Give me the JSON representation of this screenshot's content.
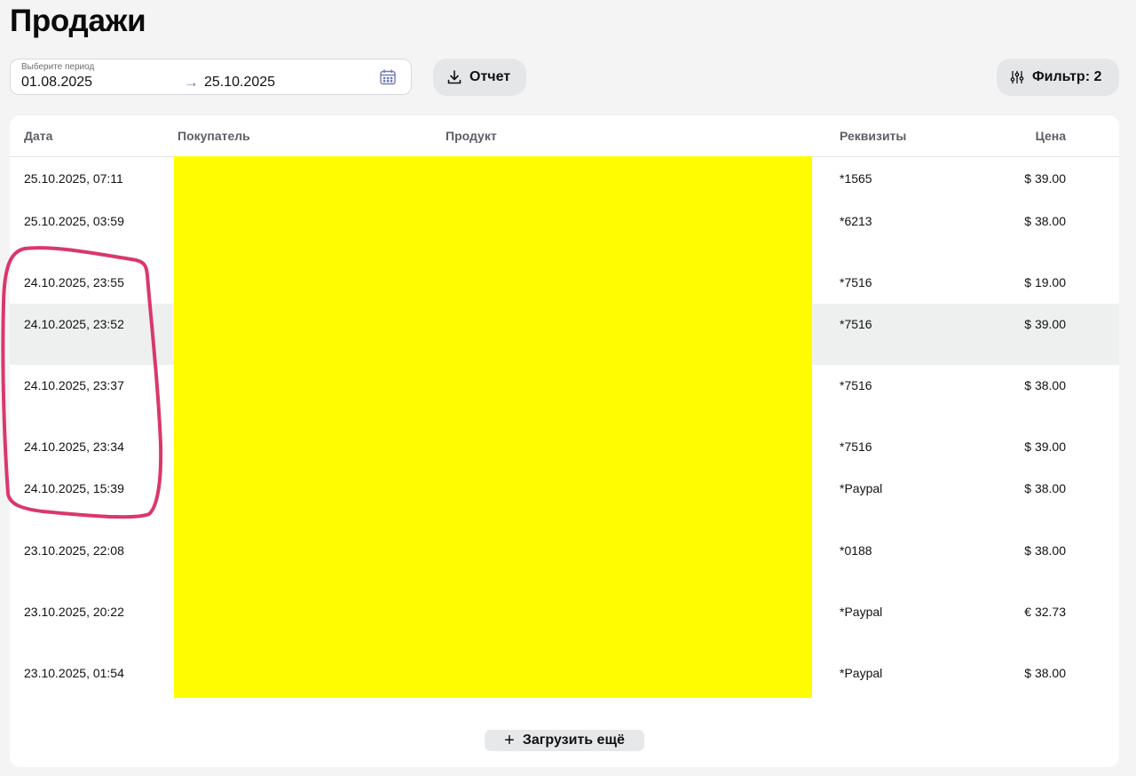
{
  "page": {
    "title": "Продажи"
  },
  "period": {
    "label": "Выберите период",
    "from": "01.08.2025",
    "arrow": "→",
    "to": "25.10.2025"
  },
  "toolbar": {
    "report_label": "Отчет",
    "filter_label": "Фильтр: 2"
  },
  "table": {
    "columns": {
      "date": "Дата",
      "buyer": "Покупатель",
      "product": "Продукт",
      "requisites": "Реквизиты",
      "price": "Цена"
    },
    "rows": [
      {
        "date": "25.10.2025, 07:11",
        "requisites": "*1565",
        "price": "$ 39.00"
      },
      {
        "date": "25.10.2025, 03:59",
        "requisites": "*6213",
        "price": "$ 38.00"
      },
      {
        "date": "24.10.2025, 23:55",
        "requisites": "*7516",
        "price": "$ 19.00"
      },
      {
        "date": "24.10.2025, 23:52",
        "requisites": "*7516",
        "price": "$ 39.00"
      },
      {
        "date": "24.10.2025, 23:37",
        "requisites": "*7516",
        "price": "$ 38.00"
      },
      {
        "date": "24.10.2025, 23:34",
        "requisites": "*7516",
        "price": "$ 39.00"
      },
      {
        "date": "24.10.2025, 15:39",
        "requisites": "*Paypal",
        "price": "$ 38.00"
      },
      {
        "date": "23.10.2025, 22:08",
        "requisites": "*0188",
        "price": "$ 38.00"
      },
      {
        "date": "23.10.2025, 20:22",
        "requisites": "*Paypal",
        "price": "€ 32.73"
      },
      {
        "date": "23.10.2025, 01:54",
        "requisites": "*Paypal",
        "price": "$ 38.00"
      }
    ]
  },
  "load_more": {
    "label": "Загрузить ещё"
  },
  "colors": {
    "redaction": "#fffc00",
    "annotation": "#d9386a",
    "highlight_row": "#eef0f0"
  }
}
